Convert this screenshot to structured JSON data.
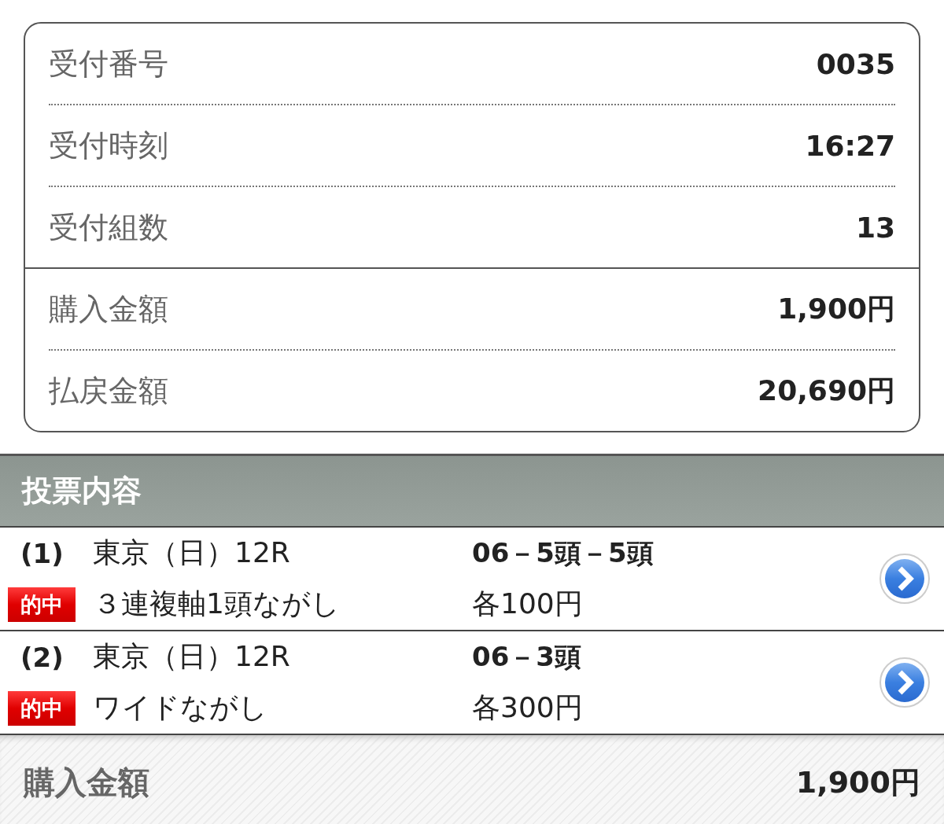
{
  "receipt_groups": [
    {
      "rows": [
        {
          "label": "受付番号",
          "value": "0035"
        },
        {
          "label": "受付時刻",
          "value": "16:27"
        },
        {
          "label": "受付組数",
          "value": "13"
        }
      ]
    },
    {
      "rows": [
        {
          "label": "購入金額",
          "value": "1,900円"
        },
        {
          "label": "払戻金額",
          "value": "20,690円"
        }
      ]
    }
  ],
  "section": {
    "title": "投票内容"
  },
  "bets": [
    {
      "number": "(1)",
      "race": "東京（日）12R",
      "badge": "的中",
      "type": "３連複軸1頭ながし",
      "combination": "06－5頭－5頭",
      "amount": "各100円"
    },
    {
      "number": "(2)",
      "race": "東京（日）12R",
      "badge": "的中",
      "type": "ワイドながし",
      "combination": "06－3頭",
      "amount": "各300円"
    }
  ],
  "footer": {
    "label": "購入金額",
    "value": "1,900円"
  }
}
